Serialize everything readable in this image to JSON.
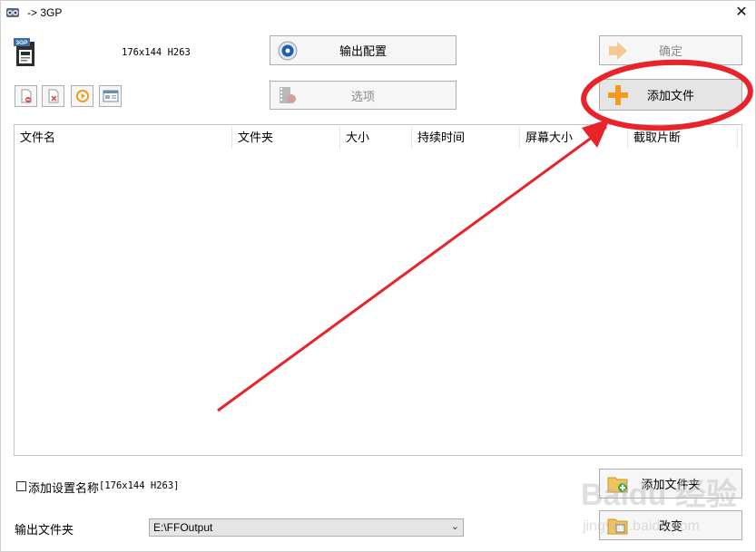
{
  "window": {
    "title": "-> 3GP",
    "close_glyph": "✕"
  },
  "format": {
    "icon": "3gp-file-icon",
    "icon_text": "3GP",
    "label": "176x144 H263"
  },
  "buttons": {
    "output_config": "输出配置",
    "options": "选项",
    "ok": "确定",
    "add_file": "添加文件",
    "add_folder": "添加文件夹",
    "change": "改变"
  },
  "button_states": {
    "options_disabled": true,
    "ok_disabled": true
  },
  "toolbar": [
    {
      "icon": "remove-file-icon"
    },
    {
      "icon": "clear-list-icon"
    },
    {
      "icon": "play-icon"
    },
    {
      "icon": "media-info-icon"
    }
  ],
  "file_list": {
    "columns": [
      "文件名",
      "文件夹",
      "大小",
      "持续时间",
      "屏幕大小",
      "截取片断"
    ],
    "rows": []
  },
  "settings": {
    "add_setting_name_label": "添加设置名称",
    "add_setting_name_value": "[176x144 H263]",
    "add_setting_name_checked": false
  },
  "output": {
    "label": "输出文件夹",
    "folder": "E:\\FFOutput"
  },
  "watermark": {
    "line1": "Baidu 经验",
    "line2": "jingyan.baidu.com"
  },
  "colors": {
    "annotation_red": "#e8242b",
    "add_file_plus": "#f39a1e"
  }
}
